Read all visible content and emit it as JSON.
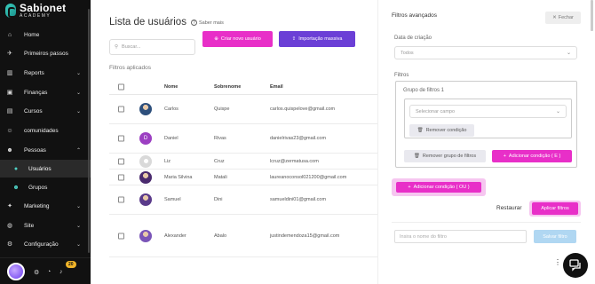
{
  "sidebar": {
    "brand": "Sabionet",
    "brand_sub": "ACADEMY",
    "items": [
      {
        "label": "Home",
        "icon": "home-icon",
        "glyph": "⌂",
        "chevron": false
      },
      {
        "label": "Primeiros passos",
        "icon": "rocket-icon",
        "glyph": "✈",
        "chevron": false
      },
      {
        "label": "Reports",
        "icon": "chart-icon",
        "glyph": "▥",
        "chevron": true
      },
      {
        "label": "Finanças",
        "icon": "wallet-icon",
        "glyph": "▣",
        "chevron": true
      },
      {
        "label": "Cursos",
        "icon": "book-icon",
        "glyph": "▤",
        "chevron": true
      },
      {
        "label": "comunidades",
        "icon": "people-icon",
        "glyph": "☺",
        "chevron": false
      },
      {
        "label": "Pessoas",
        "icon": "user-group-icon",
        "glyph": "☻",
        "chevron": true
      },
      {
        "label": "Usuários",
        "icon": "user-icon",
        "glyph": "●",
        "chevron": false
      },
      {
        "label": "Grupos",
        "icon": "group-icon",
        "glyph": "☻",
        "chevron": false
      },
      {
        "label": "Marketing",
        "icon": "megaphone-icon",
        "glyph": "✦",
        "chevron": true
      },
      {
        "label": "Site",
        "icon": "globe-icon",
        "glyph": "◍",
        "chevron": true
      },
      {
        "label": "Configuração",
        "icon": "gear-icon",
        "glyph": "⚙",
        "chevron": true
      }
    ],
    "notification_count": "20"
  },
  "main": {
    "title": "Lista de usuários",
    "help_text": "Saber mais",
    "search_placeholder": "Buscar...",
    "create_button": "Criar novo usuário",
    "import_button": "Importação massiva",
    "filters_applied": "Filtros aplicados",
    "columns": [
      "Nome",
      "Sobrenome",
      "Email"
    ],
    "rows": [
      {
        "first": "Carlos",
        "last": "Quispe",
        "email": "carlos.quispelove@gmail.com",
        "avatar": "photo",
        "color": "#2d4f7c"
      },
      {
        "first": "Daniel",
        "last": "Rivas",
        "email": "danielrivas23@gmail.com",
        "avatar": "D",
        "color": "#9c3fc2"
      },
      {
        "first": "Liz",
        "last": "Cruz",
        "email": "lcruz@zermatusa.com",
        "avatar": "blank",
        "color": "#d9d9d9"
      },
      {
        "first": "Maria Silvina",
        "last": "Matali",
        "email": "laureanoconsol021200@gmail.com",
        "avatar": "photo",
        "color": "#4a2a6e"
      },
      {
        "first": "Samuel",
        "last": "Dini",
        "email": "samueldini01@gmail.com",
        "avatar": "photo",
        "color": "#5a3a8a"
      },
      {
        "first": "Alexander",
        "last": "Abalo",
        "email": "justindemendoza15@gmail.com",
        "avatar": "photo",
        "color": "#7a55b8"
      }
    ]
  },
  "panel": {
    "title": "Filtros avançados",
    "close_button": "Fechar",
    "date_label": "Data de criação",
    "date_value": "Todos",
    "filters_label": "Filtros",
    "group_title": "Grupo de filtros 1",
    "field_placeholder": "Selecionar campo",
    "remove_condition": "Remover condição",
    "remove_group": "Remover grupo de filtros",
    "add_condition_and": "Adicionar condição ( E )",
    "add_condition_or": "Adicionar condição ( OU )",
    "restore": "Restaurar",
    "apply": "Aplicar filtros",
    "filter_name_placeholder": "Insira o nome do filtro",
    "save": "Salvar filtro"
  },
  "colors": {
    "accent_pink": "#e82fc8",
    "accent_purple": "#6b3fd6",
    "sidebar_bg": "#111111"
  }
}
